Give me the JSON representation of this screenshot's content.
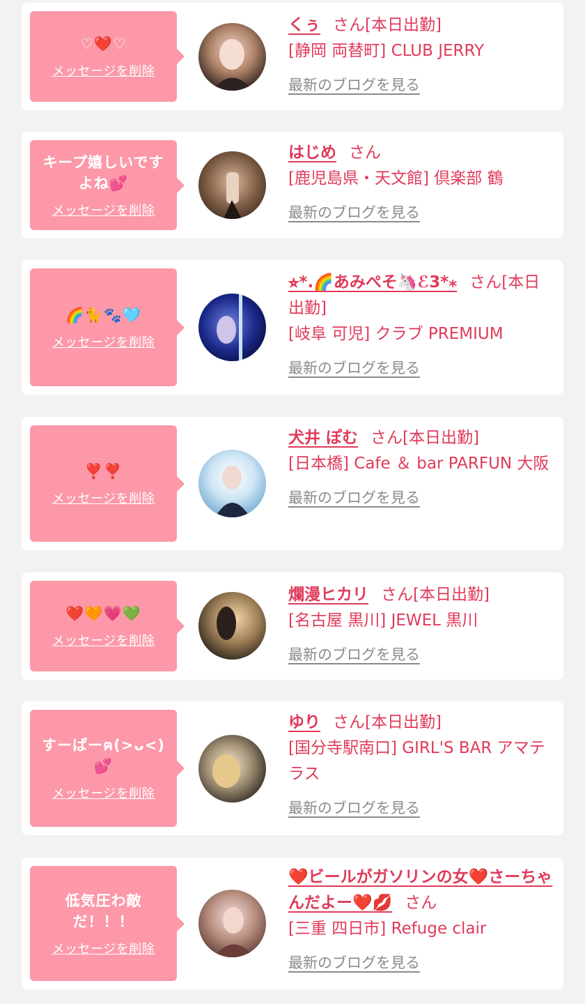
{
  "delete_label": "メッセージを削除",
  "blog_label": "最新のブログを見る",
  "colors": {
    "accent": "#e03a5a",
    "bubble": "#fc98a8",
    "muted": "#8a8a8a",
    "background": "#f2f2f3"
  },
  "items": [
    {
      "message": "♡❤️♡",
      "name": "くぅ",
      "suffix": "さん[本日出勤]",
      "store": "[静岡 両替町] CLUB JERRY"
    },
    {
      "message": "キープ嬉しいですよね💕",
      "name": "はじめ",
      "suffix": "さん",
      "store": "[鹿児島県・天文館] 倶楽部 鶴"
    },
    {
      "message": "🌈🐈🐾🩵",
      "name": "⭐︎*.🌈あみぺそ🦄ℰ3*⁎",
      "suffix": "さん[本日出勤]",
      "store": "[岐阜 可児] クラブ PREMIUM"
    },
    {
      "message": "❣️❣️",
      "name": "犬井 ぽむ",
      "suffix": "さん[本日出勤]",
      "store": "[日本橋] Cafe ＆ bar PARFUN 大阪"
    },
    {
      "message": "❤️🧡💗💚",
      "name": "爛漫ヒカリ",
      "suffix": "さん[本日出勤]",
      "store": "[名古屋 黒川] JEWEL 黒川"
    },
    {
      "message": "すーぱーฅ(>ᴗ<)💕",
      "name": "ゆり",
      "suffix": "さん[本日出勤]",
      "store": "[国分寺駅南口] GIRL'S BAR アマテラス"
    },
    {
      "message": "低気圧わ敵だ！！！",
      "name": "❤️ビールがガソリンの女❤️さーちゃんだよー❤️💋",
      "suffix": "さん",
      "store": "[三重 四日市] Refuge clair"
    }
  ]
}
